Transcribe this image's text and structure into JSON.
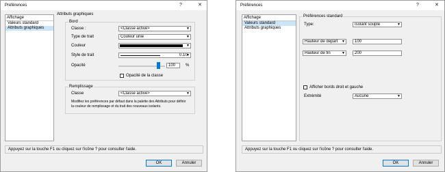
{
  "dialog1": {
    "title": "Préférences",
    "help_glyph": "?",
    "close_glyph": "✕",
    "tree": {
      "header": "Affichage",
      "items": [
        {
          "label": "Valeurs standard",
          "selected": false
        },
        {
          "label": "Attributs graphiques",
          "selected": true
        }
      ]
    },
    "section_title": "Attributs graphiques",
    "border": {
      "group_label": "Bord",
      "classe_label": "Classe :",
      "classe_value": "<Classe active>",
      "type_label": "Type de trait",
      "type_value": "Couleur unie",
      "couleur_label": "Couleur",
      "style_label": "Style de trait",
      "style_value": "0.10",
      "opacite_label": "Opacité",
      "opacite_value": "100",
      "opacite_unit": "%",
      "checkbox_label": "Opacité de la classe"
    },
    "fill": {
      "group_label": "Remplissage",
      "classe_label": "Classe",
      "classe_value": "<Classe active>",
      "note_line1": "Modifiez les préférences par défaut dans la palette des Attributs pour définir",
      "note_line2": "la couleur de remplissage et du trait des nouveaux isolants."
    },
    "status": "Appuyez sur la touche F1 ou cliquez sur l'icône ? pour consulter l'aide.",
    "ok": "OK",
    "cancel": "Annuler"
  },
  "dialog2": {
    "title": "Préférences",
    "help_glyph": "?",
    "close_glyph": "✕",
    "tree": {
      "header": "Affichage",
      "items": [
        {
          "label": "Valeurs standard",
          "selected": true
        },
        {
          "label": "Attributs graphiques",
          "selected": false
        }
      ]
    },
    "section_title": "Préférences standard",
    "type_label": "Type:",
    "type_value": "Isolant souple",
    "hauteur_depart_label": "Hauteur de départ",
    "hauteur_depart_value": "100",
    "hauteur_fin_label": "Hauteur de fin",
    "hauteur_fin_value": "200",
    "checkbox_label": "Afficher bords droit et gauche",
    "extremite_label": "Extrémité",
    "extremite_value": "Aucune",
    "status": "Appuyez sur la touche F1 ou cliquez sur l'icône ? pour consulter l'aide.",
    "ok": "OK",
    "cancel": "Annuler"
  },
  "colors": {
    "selection": "#cce4f7",
    "default_button_border": "#0078d7",
    "slider_thumb": "#0078d7",
    "swatch": "#000000"
  }
}
